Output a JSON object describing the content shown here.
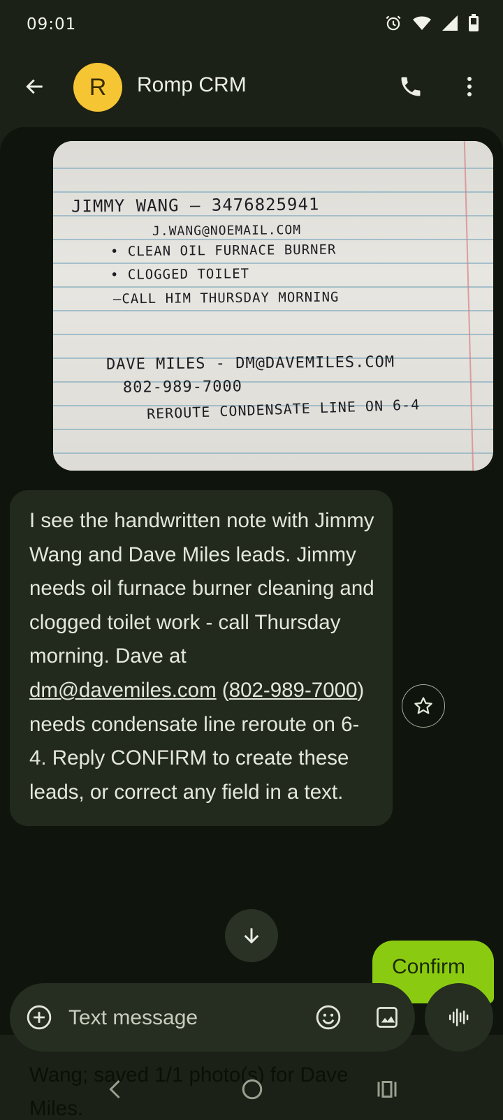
{
  "status_bar": {
    "time": "09:01"
  },
  "header": {
    "avatar_letter": "R",
    "contact_name": "Romp CRM"
  },
  "photo_note": {
    "lines": [
      "JIMMY  WANG – 3476825941",
      "J.WANG@NOEMAIL.COM",
      "• CLEAN OIL FURNACE  BURNER",
      "• CLOGGED  TOILET",
      "–CALL HIM THURSDAY MORNING",
      "DAVE  MILES  -  DM@DAVEMILES.COM",
      "802-989-7000",
      "REROUTE  CONDENSATE  LINE  ON 6-4"
    ]
  },
  "bot_message": {
    "part1": "I see the handwritten note with Jimmy Wang and Dave Miles leads. Jimmy needs oil furnace burner cleaning and clogged toilet work - call Thursday morning. Dave at ",
    "email": "dm@davemiles.com",
    "paren_open": "(",
    "phone": "802-989-7000",
    "part2": ") needs condensate line reroute on 6-4. Reply CONFIRM to create these leads, or correct any field in a text."
  },
  "sent_message": {
    "text": "Confirm"
  },
  "compose": {
    "placeholder": "Text message"
  },
  "ghost_message": {
    "text": "Wang; saved 1/1 photo(s) for Dave Miles."
  },
  "icons": {
    "back": "arrow-back-icon",
    "call": "phone-icon",
    "more": "more-vert-icon",
    "star": "star-icon",
    "scroll": "arrow-down-icon",
    "add": "add-circle-icon",
    "emoji": "emoji-icon",
    "gallery": "image-icon",
    "voice": "voice-waveform-icon"
  },
  "colors": {
    "accent": "#8acb12",
    "avatar": "#f6c533",
    "background": "#0f150c",
    "bubble": "#222a1d"
  }
}
